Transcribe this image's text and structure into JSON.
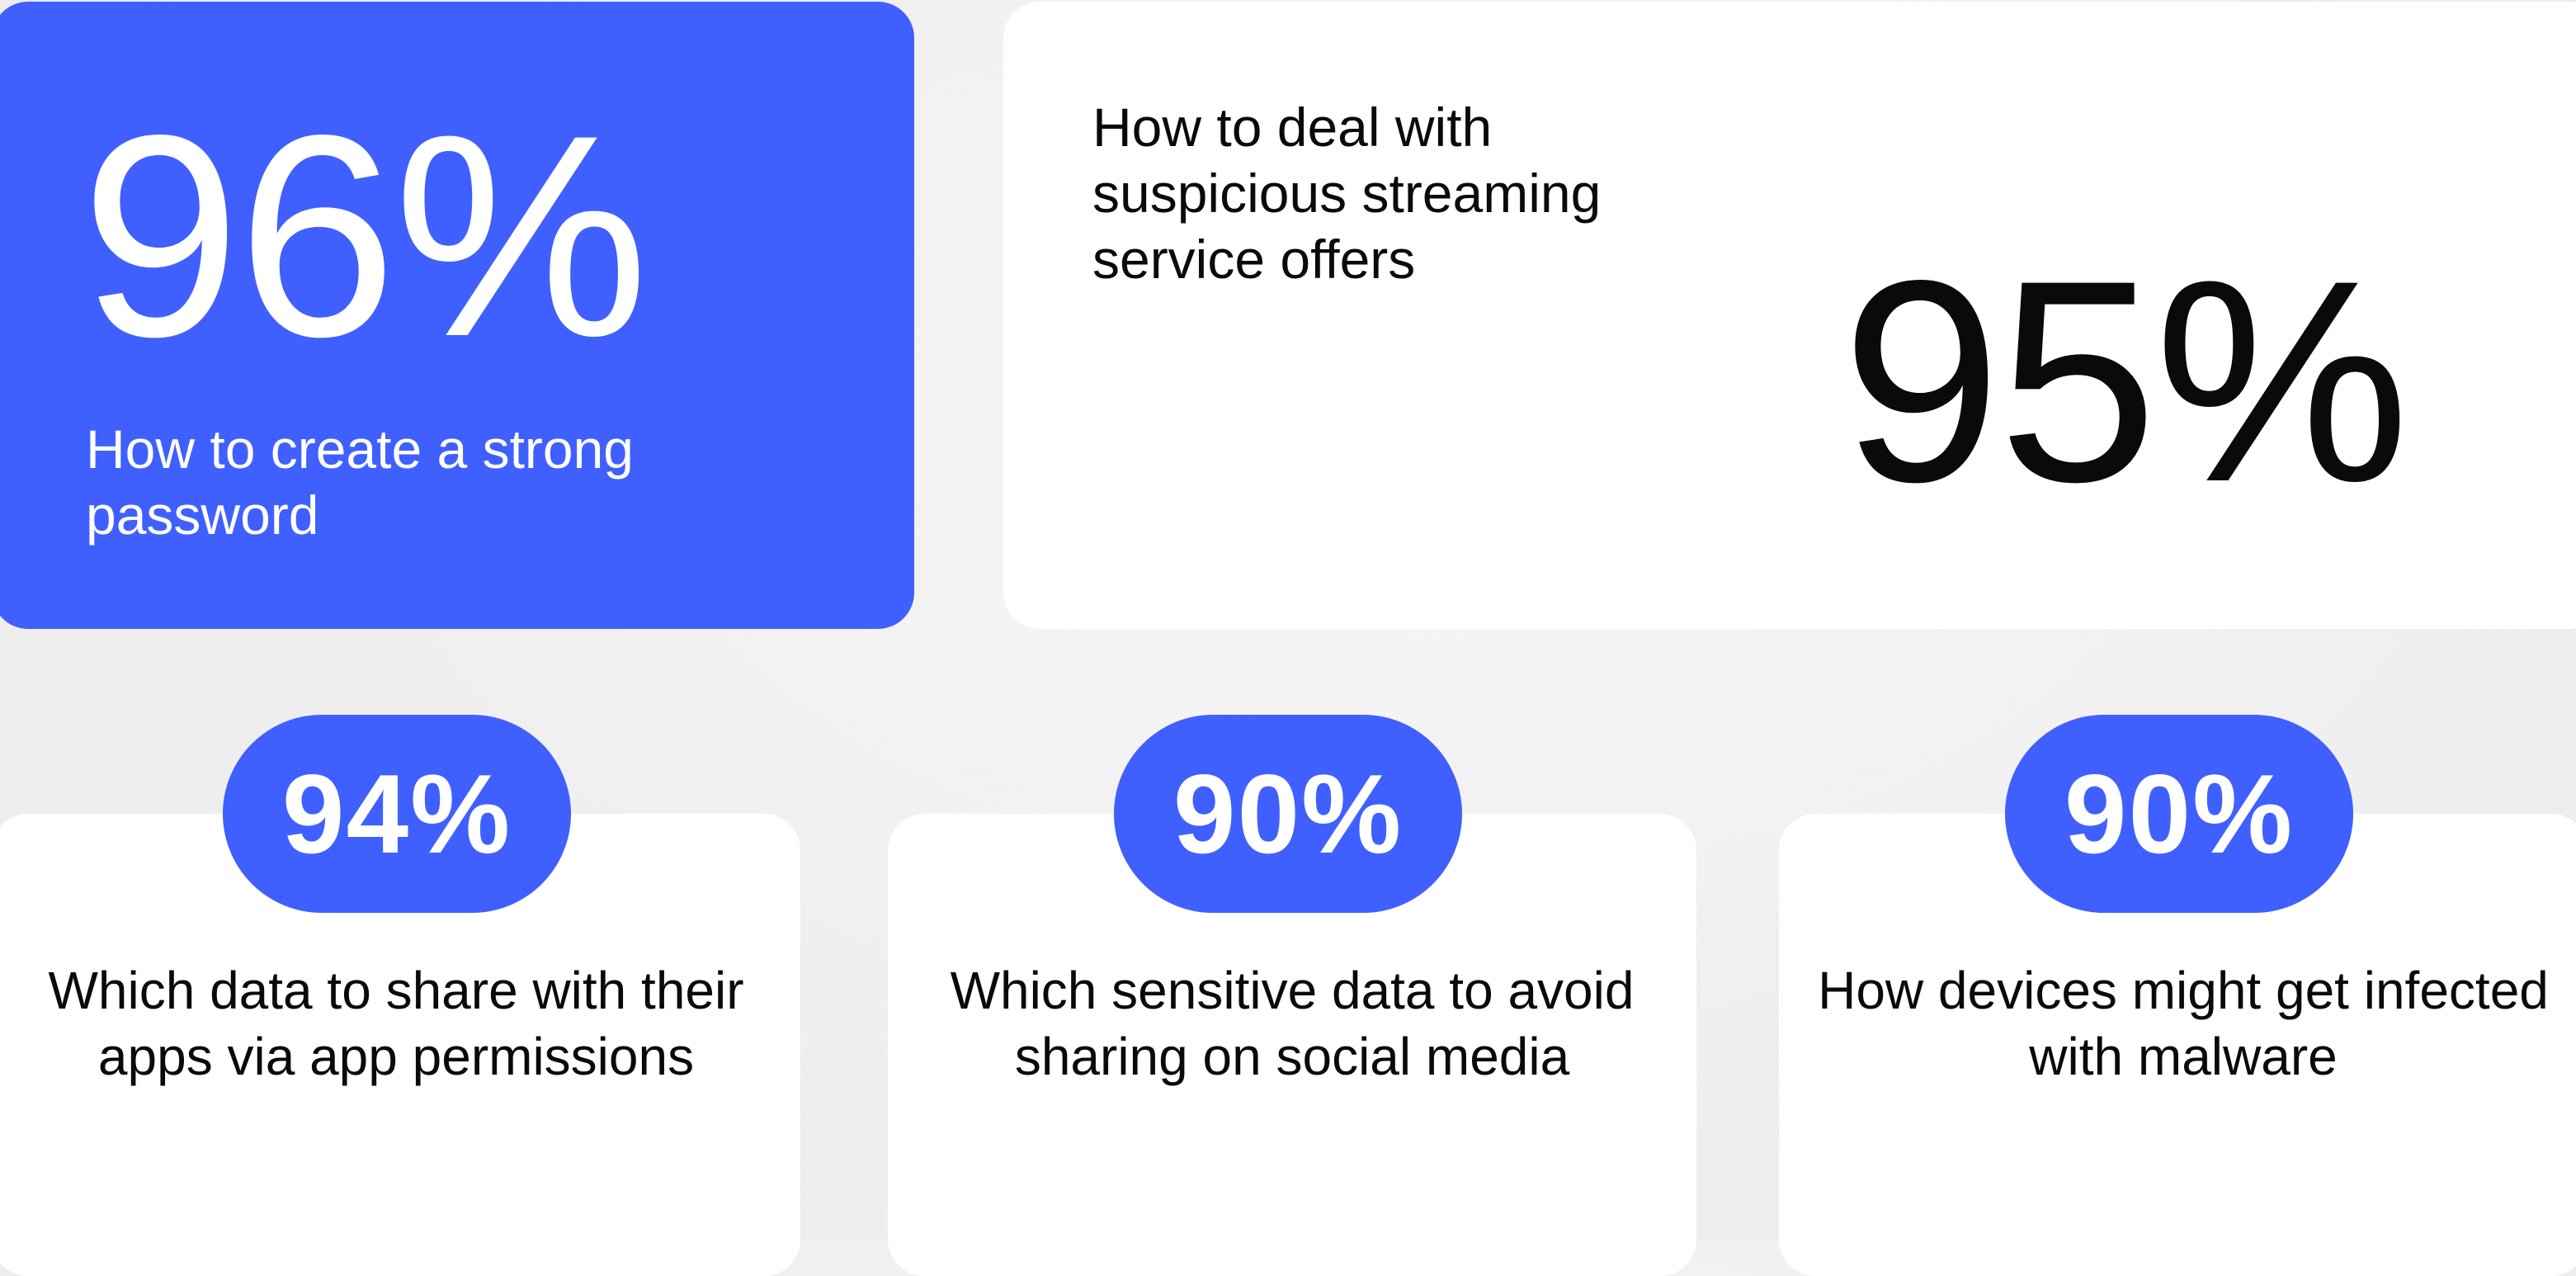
{
  "colors": {
    "accent_blue": "#3f60ff",
    "card_white": "#ffffff",
    "background": "#efefef",
    "text_dark": "#0a0a0a"
  },
  "stats": [
    {
      "value": "96%",
      "label": "How to create a strong password"
    },
    {
      "value": "95%",
      "label": "How to deal with suspicious streaming service offers"
    },
    {
      "value": "94%",
      "label": "Which data to share with their apps via app permissions"
    },
    {
      "value": "90%",
      "label": "Which sensitive data to avoid sharing on social media"
    },
    {
      "value": "90%",
      "label": "How devices might get infected with malware"
    }
  ]
}
